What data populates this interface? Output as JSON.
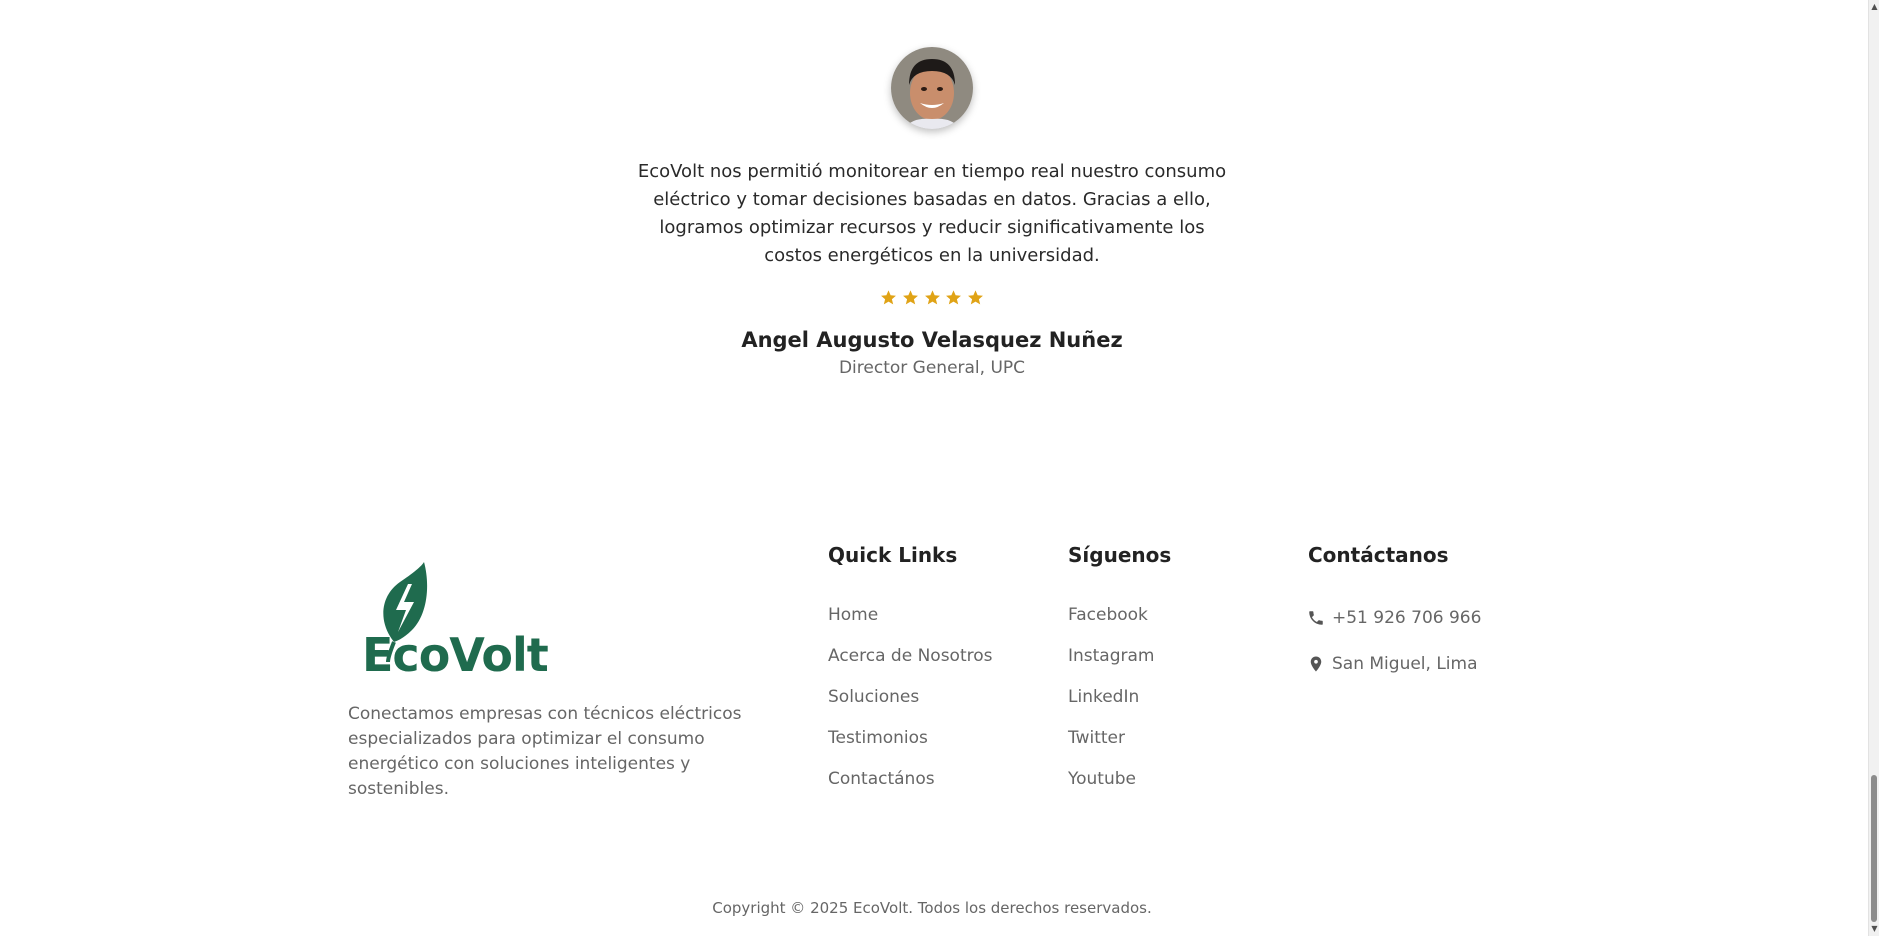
{
  "testimonial": {
    "quote": "EcoVolt nos permitió monitorear en tiempo real nuestro consumo eléctrico y tomar decisiones basadas en datos. Gracias a ello, logramos optimizar recursos y reducir significativamente los costos energéticos en la universidad.",
    "rating": 5,
    "star_color": "#e0a316",
    "author_name": "Angel Augusto Velasquez Nuñez",
    "author_role": "Director General, UPC"
  },
  "footer": {
    "logo_text": "EcoVolt",
    "brand_color": "#1f6b4e",
    "description": "Conectamos empresas con técnicos eléctricos especializados para optimizar el consumo energético con soluciones inteligentes y sostenibles.",
    "quick_links": {
      "title": "Quick Links",
      "items": [
        "Home",
        "Acerca de Nosotros",
        "Soluciones",
        "Testimonios",
        "Contactános"
      ]
    },
    "social": {
      "title": "Síguenos",
      "items": [
        "Facebook",
        "Instagram",
        "LinkedIn",
        "Twitter",
        "Youtube"
      ]
    },
    "contact": {
      "title": "Contáctanos",
      "phone": "+51 926 706 966",
      "location": "San Miguel, Lima"
    },
    "copyright": "Copyright © 2025 EcoVolt. Todos los derechos reservados."
  }
}
